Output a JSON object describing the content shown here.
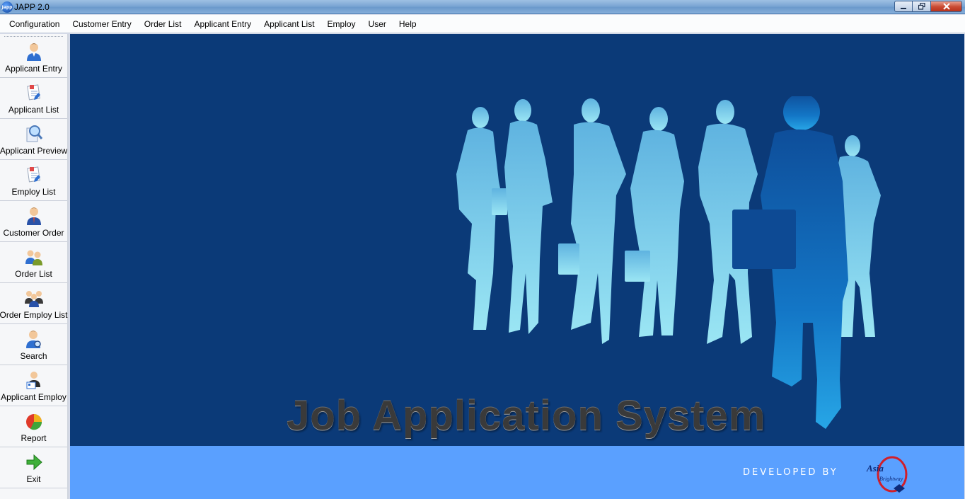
{
  "window": {
    "title": "JAPP 2.0",
    "app_icon_text": "Japp"
  },
  "menu": [
    {
      "label": "Configuration"
    },
    {
      "label": "Customer Entry"
    },
    {
      "label": "Order List"
    },
    {
      "label": "Applicant Entry"
    },
    {
      "label": "Applicant List"
    },
    {
      "label": "Employ"
    },
    {
      "label": "User"
    },
    {
      "label": "Help"
    }
  ],
  "sidebar": {
    "items": [
      {
        "label": "Applicant Entry",
        "icon": "person-icon"
      },
      {
        "label": "Applicant List",
        "icon": "document-list-icon"
      },
      {
        "label": "Applicant Preview",
        "icon": "magnifier-preview-icon"
      },
      {
        "label": "Employ List",
        "icon": "document-list-icon"
      },
      {
        "label": "Customer Order",
        "icon": "businessman-icon"
      },
      {
        "label": "Order List",
        "icon": "two-people-icon"
      },
      {
        "label": "Order Employ List",
        "icon": "group-people-icon"
      },
      {
        "label": "Search",
        "icon": "person-search-icon"
      },
      {
        "label": "Applicant Employ",
        "icon": "person-card-icon"
      },
      {
        "label": "Report",
        "icon": "pie-chart-icon"
      },
      {
        "label": "Exit",
        "icon": "green-arrow-icon"
      }
    ]
  },
  "splash": {
    "headline": "Job Application System",
    "developed_by": "DEVELOPED BY",
    "brand_name": "Asia",
    "brand_sub": "Brightway",
    "colors": {
      "background": "#0b3a78",
      "footer": "#5aa0ff",
      "silhouette": "#7fd4ec"
    }
  }
}
